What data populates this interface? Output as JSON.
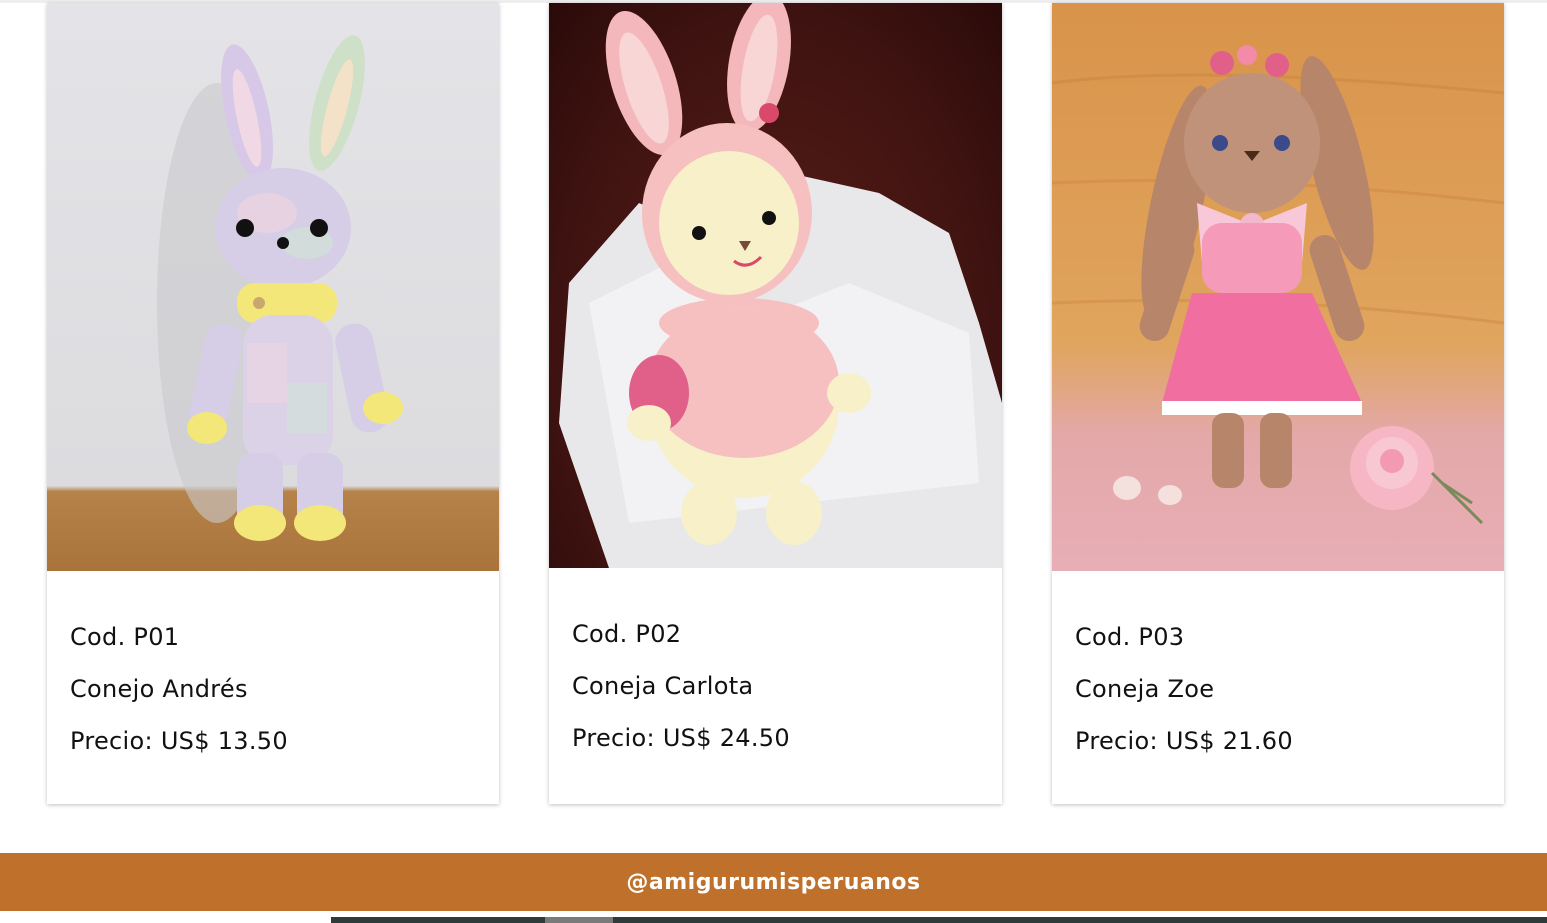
{
  "products": [
    {
      "code": "Cod. P01",
      "name": "Conejo Andrés",
      "price": "Precio: US$ 13.50",
      "image_label": "crochet bunny pastel rainbow"
    },
    {
      "code": "Cod. P02",
      "name": "Coneja Carlota",
      "price": "Precio: US$ 24.50",
      "image_label": "crochet bunny pink with egg"
    },
    {
      "code": "Cod. P03",
      "name": "Coneja Zoe",
      "price": "Precio: US$ 21.60",
      "image_label": "crochet bunny brown with pink dress"
    }
  ],
  "footer": {
    "handle": "@amigurumisperuanos"
  },
  "colors": {
    "footer_bg": "#bf702a",
    "footer_text": "#ffffff",
    "text": "#111111"
  }
}
